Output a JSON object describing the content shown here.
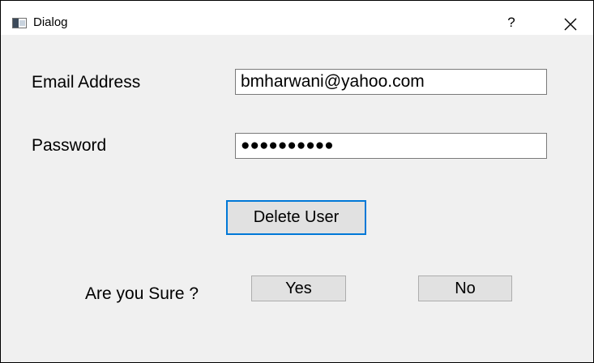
{
  "window": {
    "title": "Dialog",
    "help_label": "?"
  },
  "form": {
    "email_label": "Email Address",
    "email_value": "bmharwani@yahoo.com",
    "password_label": "Password",
    "password_mask": "●●●●●●●●●●"
  },
  "actions": {
    "delete_label": "Delete User"
  },
  "confirm": {
    "prompt": "Are you Sure ?",
    "yes_label": "Yes",
    "no_label": "No"
  },
  "icons": {
    "app": "window-app-icon",
    "close": "close-icon"
  },
  "colors": {
    "dialog_bg": "#f0f0f0",
    "focus_accent": "#0078d7",
    "button_bg": "#e1e1e1"
  }
}
